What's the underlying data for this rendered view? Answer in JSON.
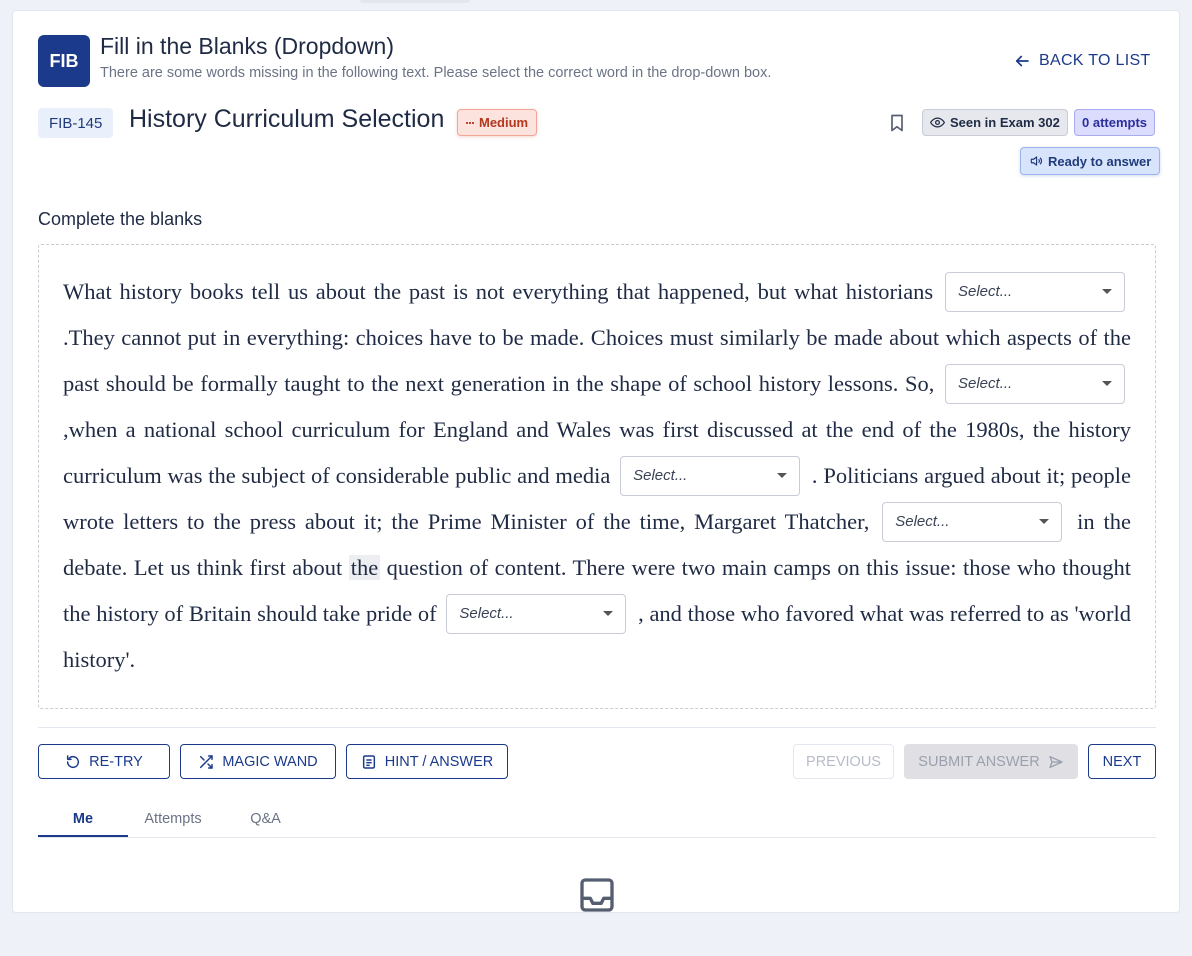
{
  "header": {
    "logo": "FIB",
    "title": "Fill in the Blanks (Dropdown)",
    "subtitle": "There are some words missing in the following text. Please select the correct word in the drop-down box.",
    "back_label": "BACK TO LIST"
  },
  "question": {
    "id": "FIB-145",
    "name": "History Curriculum Selection",
    "difficulty": "Medium",
    "seen_label": "Seen in Exam 302",
    "attempts_label": "0 attempts",
    "status_label": "Ready to answer"
  },
  "section_label": "Complete the blanks",
  "passage": {
    "dropdown_placeholder": "Select...",
    "seg0": "What history books tell us about the past is not everything that happened, but what historians ",
    "seg1": " .They cannot put in everything: choices have to be made. Choices must similarly be made about which aspects of the past should be formally taught to the next generation in the shape of school history lessons. So, ",
    "seg2": " ,when a national school curriculum for England and Wales was first discussed at the end of the 1980s, the history curriculum was the subject of considerable public and media ",
    "seg3": " . Politicians argued about it; people wrote letters to the press about it; the Prime Minister of the time, Margaret Thatcher, ",
    "seg4a": " in the debate. Let us think first about ",
    "seg4_hl": "the",
    "seg4b": " question of content. There were two main camps on this issue: those who thought the history of Britain should take pride of ",
    "seg5": " , and those who favored what was referred to as 'world history'."
  },
  "actions": {
    "retry": "RE-TRY",
    "magic_wand": "MAGIC WAND",
    "hint": "HINT / ANSWER",
    "previous": "PREVIOUS",
    "submit": "SUBMIT ANSWER",
    "next": "NEXT"
  },
  "tabs": [
    "Me",
    "Attempts",
    "Q&A"
  ],
  "colors": {
    "primary": "#1b3a8c",
    "difficulty_medium": "#b2381e",
    "attempts": "#2a2f9a",
    "status": "#1f3b7a"
  }
}
